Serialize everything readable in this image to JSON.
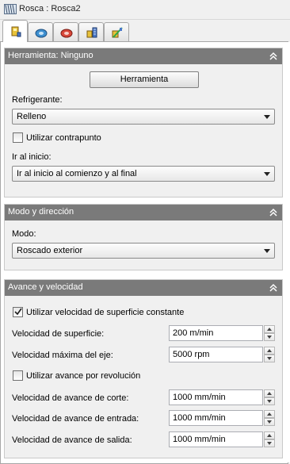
{
  "window": {
    "title": "Rosca : Rosca2"
  },
  "tabs": [
    {
      "icon": "tool-tab-icon",
      "active": true
    },
    {
      "icon": "geometry-tab-icon",
      "active": false
    },
    {
      "icon": "heights-tab-icon",
      "active": false
    },
    {
      "icon": "passes-tab-icon",
      "active": false
    },
    {
      "icon": "linking-tab-icon",
      "active": false
    }
  ],
  "tool_panel": {
    "title": "Herramienta: Ninguno",
    "tool_button": "Herramienta",
    "coolant_label": "Refrigerante:",
    "coolant_value": "Relleno",
    "tailstock_label": "Utilizar contrapunto",
    "tailstock_checked": false,
    "home_label": "Ir al inicio:",
    "home_value": "Ir al inicio al comienzo y al final"
  },
  "mode_panel": {
    "title": "Modo y dirección",
    "mode_label": "Modo:",
    "mode_value": "Roscado exterior"
  },
  "feed_panel": {
    "title": "Avance y velocidad",
    "css_label": "Utilizar velocidad de superficie constante",
    "css_checked": true,
    "surface_speed_label": "Velocidad de superficie:",
    "surface_speed_value": "200 m/min",
    "max_spindle_label": "Velocidad máxima del eje:",
    "max_spindle_value": "5000 rpm",
    "feed_per_rev_label": "Utilizar avance por revolución",
    "feed_per_rev_checked": false,
    "cutting_feed_label": "Velocidad de avance de corte:",
    "cutting_feed_value": "1000 mm/min",
    "lead_in_label": "Velocidad de avance de entrada:",
    "lead_in_value": "1000 mm/min",
    "lead_out_label": "Velocidad de avance de salida:",
    "lead_out_value": "1000 mm/min"
  },
  "colors": {
    "panel_header": "#7a7a7a",
    "background": "#f0f0f0"
  }
}
